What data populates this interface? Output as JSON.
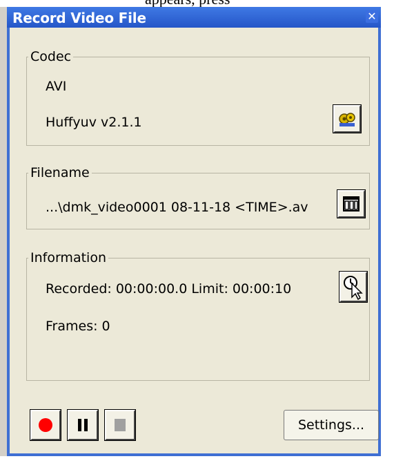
{
  "caption_fragment": "appears, press",
  "window": {
    "title": "Record Video File",
    "close_symbol": "✕"
  },
  "codec": {
    "legend": "Codec",
    "container": "AVI",
    "name": "Huffyuv v2.1.1",
    "properties_icon": "gear-icon"
  },
  "filename": {
    "legend": "Filename",
    "value": "...\\dmk_video0001 08-11-18 <TIME>.av",
    "browse_icon": "film-icon"
  },
  "information": {
    "legend": "Information",
    "recorded": "Recorded: 00:00:00.0 Limit: 00:00:10",
    "frames": "Frames: 0",
    "timer_icon": "clock-cursor-icon"
  },
  "controls": {
    "record_icon": "record-icon",
    "pause_icon": "pause-icon",
    "stop_icon": "stop-icon",
    "settings_label": "Settings..."
  },
  "colors": {
    "titlebar": "#2b5fd9",
    "window_bg": "#ece9d8",
    "record": "#ff0000",
    "stop_disabled": "#a0a0a0"
  }
}
